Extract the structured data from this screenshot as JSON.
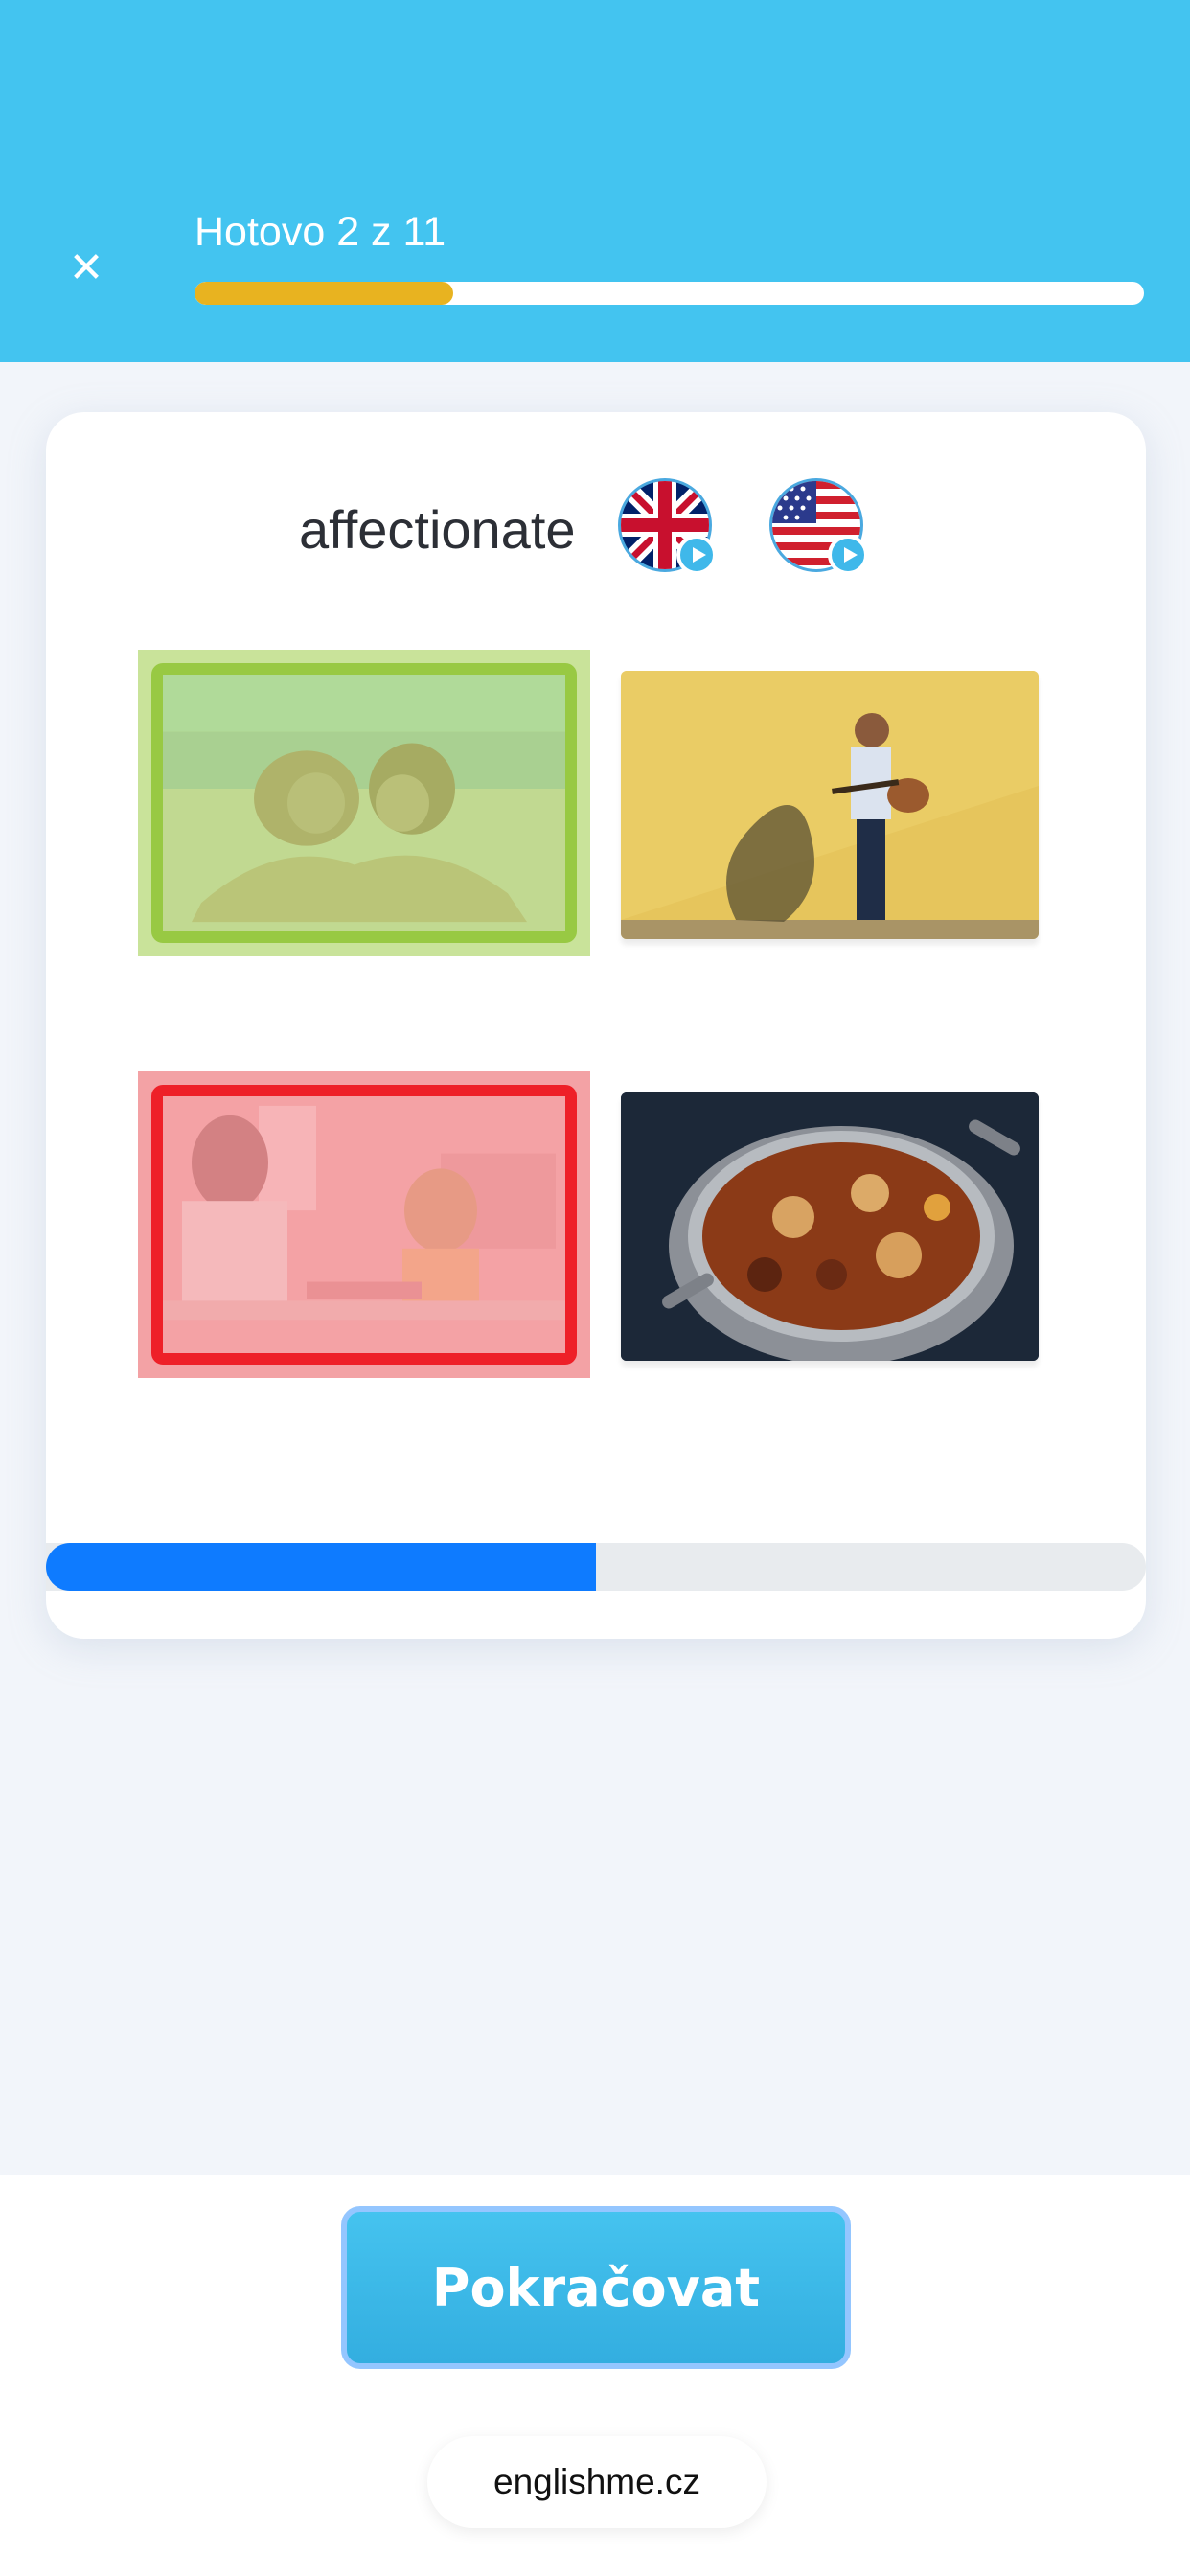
{
  "header": {
    "close_icon": "close-icon",
    "progress_label": "Hotovo 2 z 11",
    "progress_fraction": 0.2727,
    "progress_color": "#e8b320"
  },
  "exercise": {
    "word": "affectionate",
    "audio": [
      {
        "icon": "uk-flag-icon",
        "accent": "british"
      },
      {
        "icon": "us-flag-icon",
        "accent": "american"
      }
    ],
    "options": [
      {
        "subject": "couple-on-beach-photo",
        "state": "correct"
      },
      {
        "subject": "man-with-guitar-photo",
        "state": "neutral"
      },
      {
        "subject": "teacher-and-child-photo",
        "state": "wrong"
      },
      {
        "subject": "stew-pot-photo",
        "state": "neutral"
      }
    ],
    "timer_fraction": 0.5,
    "timer_color": "#0e7bff",
    "correct_color": "#98c943",
    "wrong_color": "#ee2028"
  },
  "footer": {
    "continue_label": "Pokračovat",
    "site_label": "englishme.cz"
  }
}
